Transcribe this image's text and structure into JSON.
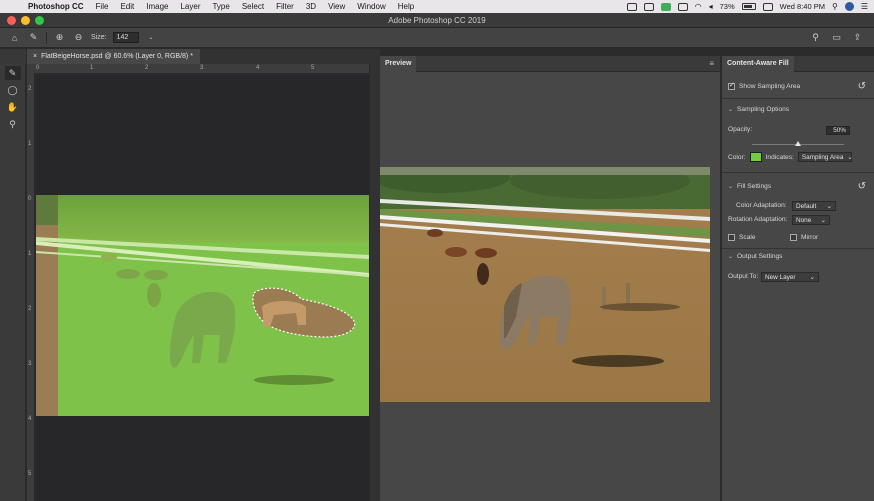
{
  "menubar": {
    "app": "Photoshop CC",
    "items": [
      "File",
      "Edit",
      "Image",
      "Layer",
      "Type",
      "Select",
      "Filter",
      "3D",
      "View",
      "Window",
      "Help"
    ],
    "battery": "73%",
    "clock": "Wed 8:40 PM"
  },
  "window": {
    "title": "Adobe Photoshop CC 2019"
  },
  "options": {
    "size_label": "Size:",
    "size_value": "142"
  },
  "document": {
    "tab_label": "FlatBeigeHorse.psd @ 60.6% (Layer 0, RGB/8) *",
    "close_glyph": "×"
  },
  "rulers": {
    "top": [
      "0",
      "1",
      "2",
      "3",
      "4",
      "5"
    ],
    "left": [
      "2",
      "1",
      "0",
      "1",
      "2",
      "3",
      "4",
      "5"
    ]
  },
  "preview": {
    "tab_label": "Preview"
  },
  "caf": {
    "tab_label": "Content-Aware Fill",
    "show_sampling_area": "Show Sampling Area",
    "sampling_options": "Sampling Options",
    "opacity_label": "Opacity:",
    "opacity_value": "50%",
    "opacity_fraction": 0.5,
    "color_label": "Color:",
    "overlay_color": "#6fce3c",
    "indicates_label": "Indicates:",
    "indicates_value": "Sampling Area",
    "fill_settings": "Fill Settings",
    "color_adaptation_label": "Color Adaptation:",
    "color_adaptation_value": "Default",
    "rotation_adaptation_label": "Rotation Adaptation:",
    "rotation_adaptation_value": "None",
    "scale_label": "Scale",
    "mirror_label": "Mirror",
    "output_settings": "Output Settings",
    "output_to_label": "Output To:",
    "output_to_value": "New Layer"
  }
}
